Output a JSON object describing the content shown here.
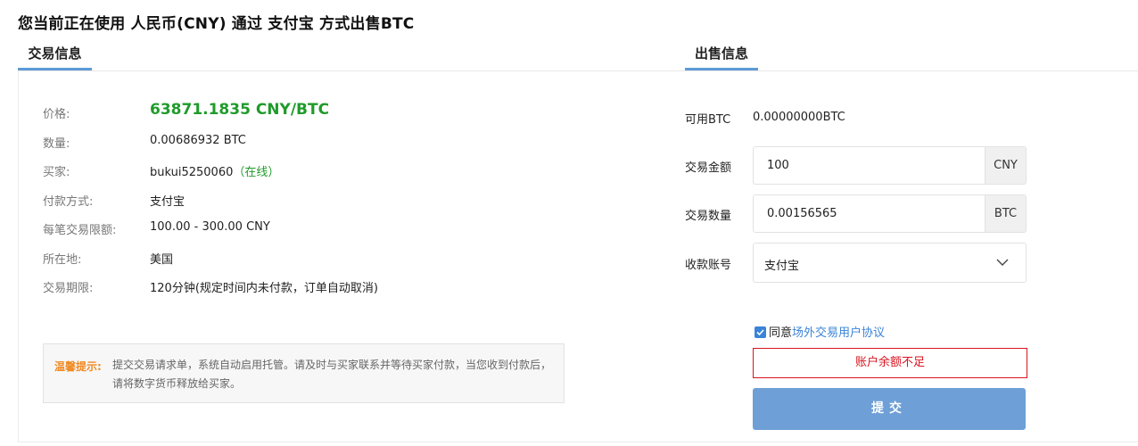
{
  "page": {
    "title": "您当前正在使用 人民币(CNY) 通过 支付宝 方式出售BTC"
  },
  "tabs": {
    "trade_info": "交易信息",
    "sell_info": "出售信息"
  },
  "trade_info": {
    "price_label": "价格:",
    "price_value": "63871.1835 CNY/BTC",
    "quantity_label": "数量:",
    "quantity_value": "0.00686932 BTC",
    "buyer_label": "买家:",
    "buyer_name": "bukui5250060",
    "buyer_status": "（在线）",
    "payment_label": "付款方式:",
    "payment_value": "支付宝",
    "limit_label": "每笔交易限额:",
    "limit_value": "100.00 - 300.00 CNY",
    "location_label": "所在地:",
    "location_value": "美国",
    "period_label": "交易期限:",
    "period_value": "120分钟(规定时间内未付款，订单自动取消)"
  },
  "tip": {
    "label": "温馨提示:",
    "text": "提交交易请求单，系统自动启用托管。请及时与买家联系并等待买家付款，当您收到付款后，请将数字货币释放给买家。"
  },
  "sell_form": {
    "available_label": "可用BTC",
    "available_value": "0.00000000BTC",
    "amount_label": "交易金额",
    "amount_value": "100",
    "amount_unit": "CNY",
    "qty_label": "交易数量",
    "qty_value": "0.00156565",
    "qty_unit": "BTC",
    "account_label": "收款账号",
    "account_value": "支付宝",
    "agree_prefix": "同意",
    "agree_link": "场外交易用户协议",
    "agree_checked": true,
    "error_text": "账户余额不足",
    "submit_label": "提交"
  },
  "colors": {
    "accent": "#5d9bd6",
    "price_green": "#1f9b2b",
    "error_red": "#d9141f",
    "submit_bg": "#6e9fd6",
    "tip_orange": "#f08a24"
  },
  "icons": {
    "checkbox": "check-icon",
    "select": "chevron-down-icon"
  }
}
